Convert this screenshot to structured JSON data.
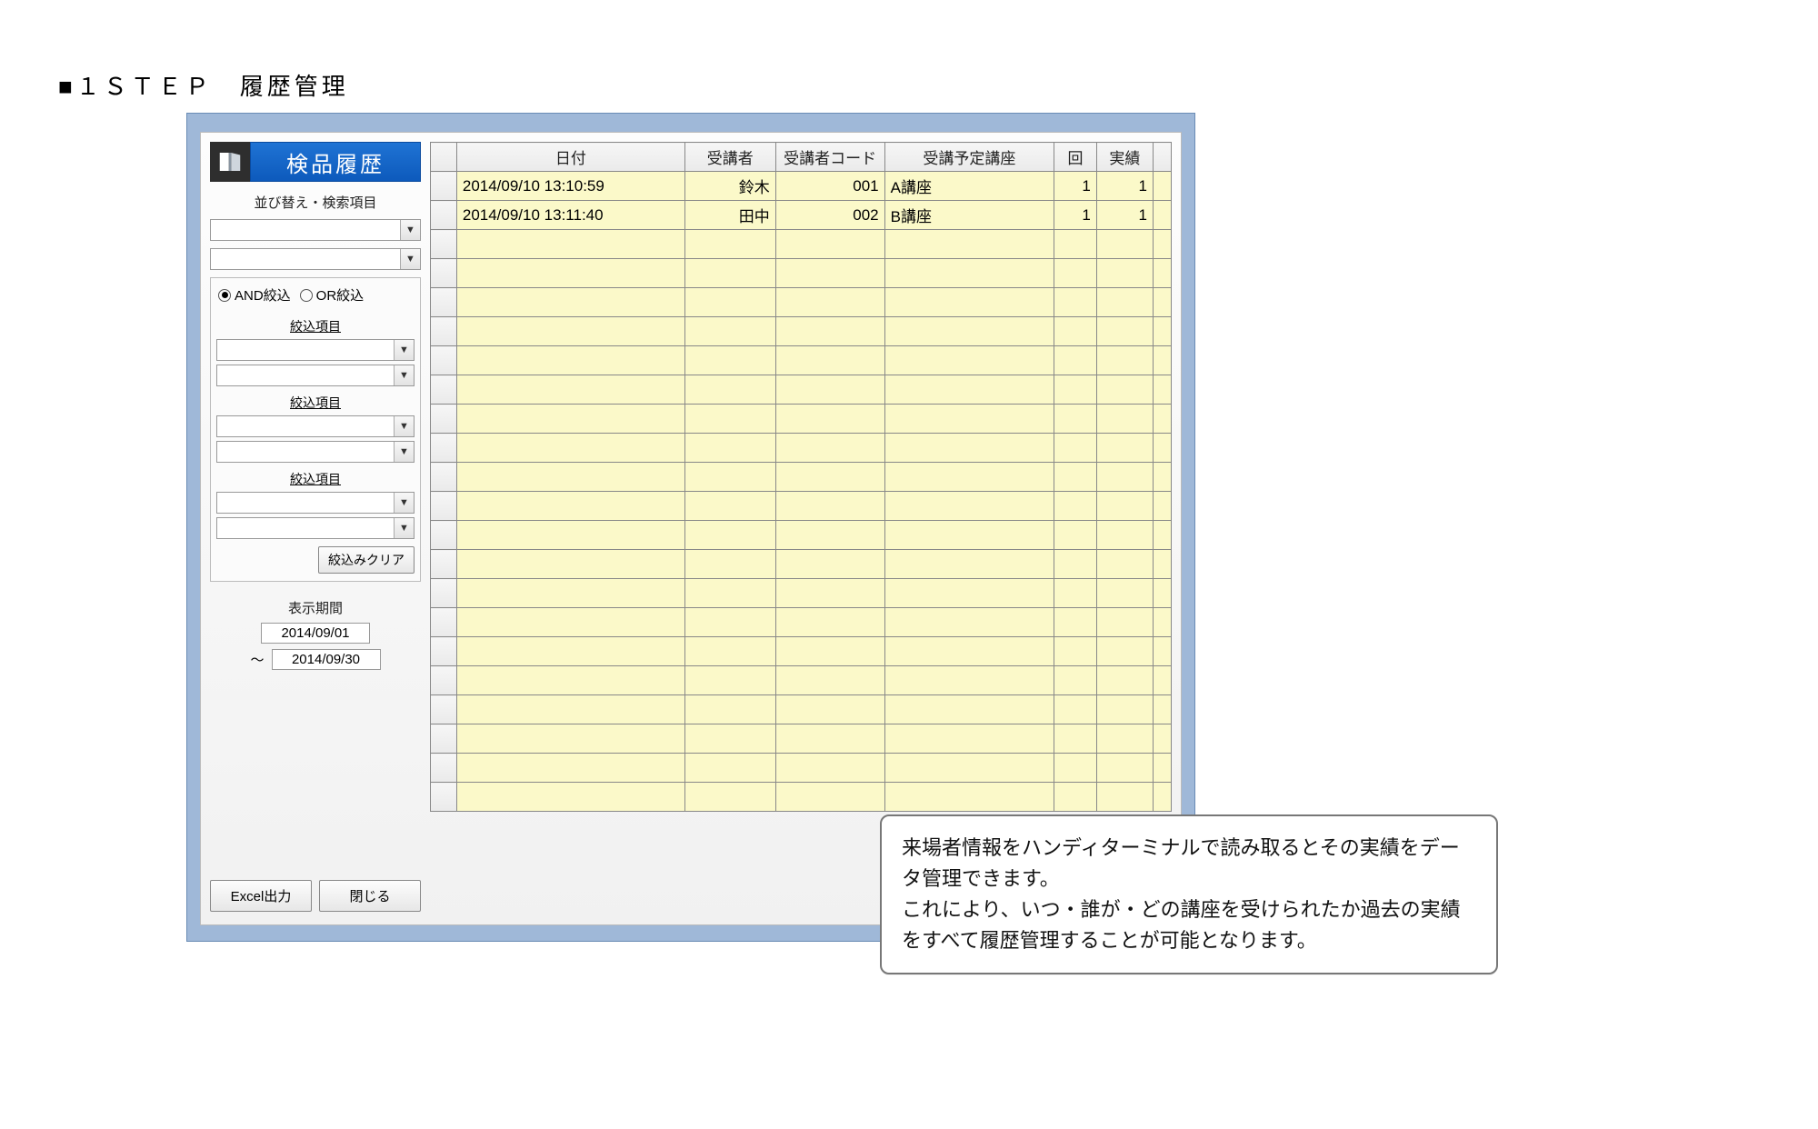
{
  "page": {
    "heading": "■１ＳＴＥＰ　履歴管理"
  },
  "sidebar": {
    "title": "検品履歴",
    "sort_label": "並び替え・検索項目",
    "filter": {
      "and_label": "AND絞込",
      "or_label": "OR絞込",
      "group_label": "絞込項目",
      "clear_button": "絞込みクリア"
    },
    "period": {
      "label": "表示期間",
      "from": "2014/09/01",
      "separator": "～",
      "to": "2014/09/30"
    },
    "buttons": {
      "excel": "Excel出力",
      "close": "閉じる"
    }
  },
  "table": {
    "headers": {
      "date": "日付",
      "student": "受講者",
      "code": "受講者コード",
      "course": "受講予定講座",
      "count": "回",
      "result": "実績"
    },
    "rows": [
      {
        "date": "2014/09/10 13:10:59",
        "student": "鈴木",
        "code": "001",
        "course": "A講座",
        "count": "1",
        "result": "1"
      },
      {
        "date": "2014/09/10 13:11:40",
        "student": "田中",
        "code": "002",
        "course": "B講座",
        "count": "1",
        "result": "1"
      }
    ],
    "empty_row_count": 20
  },
  "tooltip": {
    "line1": "来場者情報をハンディターミナルで読み取るとその実績をデータ管理できます。",
    "line2": "これにより、いつ・誰が・どの講座を受けられたか過去の実績をすべて履歴管理することが可能となります。"
  }
}
